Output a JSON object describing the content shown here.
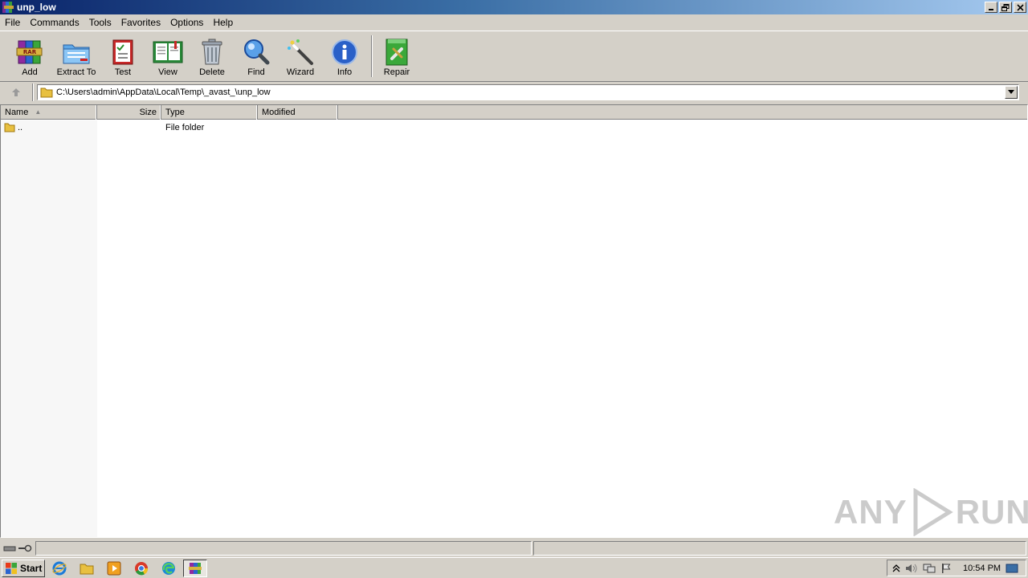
{
  "window": {
    "title": "unp_low",
    "controls": [
      "minimize",
      "restore",
      "close"
    ]
  },
  "menu": [
    "File",
    "Commands",
    "Tools",
    "Favorites",
    "Options",
    "Help"
  ],
  "toolbar": {
    "buttons": [
      {
        "id": "add",
        "label": "Add",
        "icon": "winrar-add-icon"
      },
      {
        "id": "extract",
        "label": "Extract To",
        "icon": "extract-folder-icon"
      },
      {
        "id": "test",
        "label": "Test",
        "icon": "test-checklist-icon"
      },
      {
        "id": "view",
        "label": "View",
        "icon": "book-view-icon"
      },
      {
        "id": "delete",
        "label": "Delete",
        "icon": "trash-icon"
      },
      {
        "id": "find",
        "label": "Find",
        "icon": "magnifier-icon"
      },
      {
        "id": "wizard",
        "label": "Wizard",
        "icon": "magic-wand-icon"
      },
      {
        "id": "info",
        "label": "Info",
        "icon": "info-icon"
      },
      {
        "id": "repair",
        "label": "Repair",
        "icon": "repair-icon"
      }
    ]
  },
  "address": {
    "path": "C:\\Users\\admin\\AppData\\Local\\Temp\\_avast_\\unp_low"
  },
  "file_list": {
    "columns": [
      "Name",
      "Size",
      "Type",
      "Modified"
    ],
    "sorted_by": "Name",
    "rows": [
      {
        "name": "..",
        "size": "",
        "type": "File folder",
        "modified": ""
      }
    ]
  },
  "watermark": {
    "left": "ANY",
    "right": "RUN"
  },
  "taskbar": {
    "start_label": "Start",
    "clock": "10:54 PM"
  }
}
